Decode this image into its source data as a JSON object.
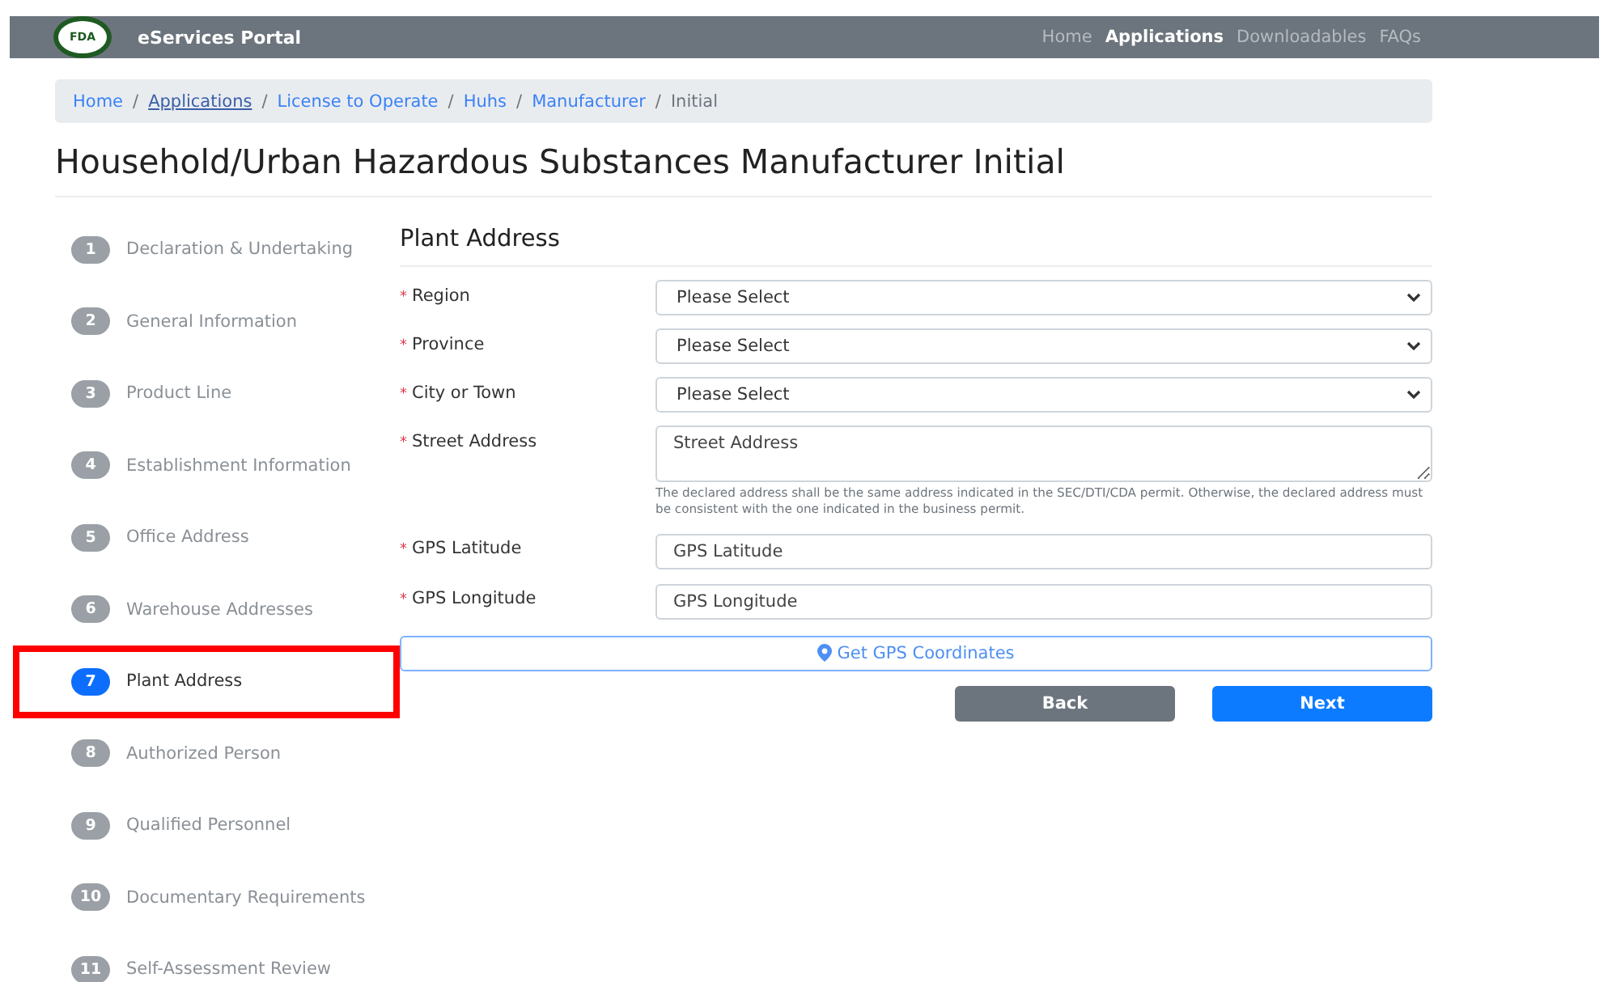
{
  "navbar": {
    "logo": "FDA",
    "title": "eServices Portal",
    "links": [
      {
        "label": "Home",
        "selected": false
      },
      {
        "label": "Applications",
        "selected": true
      },
      {
        "label": "Downloadables",
        "selected": false
      },
      {
        "label": "FAQs",
        "selected": false
      }
    ]
  },
  "breadcrumb": [
    {
      "kind": "link",
      "label": "Home",
      "underlined": false
    },
    {
      "kind": "separator",
      "label": "/"
    },
    {
      "kind": "link",
      "label": "Applications",
      "underlined": true
    },
    {
      "kind": "separator",
      "label": "/"
    },
    {
      "kind": "link",
      "label": "License to Operate",
      "underlined": false
    },
    {
      "kind": "separator",
      "label": "/"
    },
    {
      "kind": "link",
      "label": "Huhs",
      "underlined": false
    },
    {
      "kind": "separator",
      "label": "/"
    },
    {
      "kind": "link",
      "label": "Manufacturer",
      "underlined": false
    },
    {
      "kind": "separator",
      "label": "/"
    },
    {
      "kind": "current",
      "label": "Initial"
    }
  ],
  "page_title": "Household/Urban Hazardous Substances Manufacturer Initial",
  "steps": [
    {
      "number": "1",
      "label": "Declaration & Undertaking",
      "selected": false,
      "highlighted": false
    },
    {
      "number": "2",
      "label": "General Information",
      "selected": false,
      "highlighted": false
    },
    {
      "number": "3",
      "label": "Product Line",
      "selected": false,
      "highlighted": false
    },
    {
      "number": "4",
      "label": "Establishment Information",
      "selected": false,
      "highlighted": false
    },
    {
      "number": "5",
      "label": "Office Address",
      "selected": false,
      "highlighted": false
    },
    {
      "number": "6",
      "label": "Warehouse Addresses",
      "selected": false,
      "highlighted": false
    },
    {
      "number": "7",
      "label": "Plant Address",
      "selected": true,
      "highlighted": true
    },
    {
      "number": "8",
      "label": "Authorized Person",
      "selected": false,
      "highlighted": false
    },
    {
      "number": "9",
      "label": "Qualified Personnel",
      "selected": false,
      "highlighted": false
    },
    {
      "number": "10",
      "label": "Documentary Requirements",
      "selected": false,
      "highlighted": false
    },
    {
      "number": "11",
      "label": "Self-Assessment Review",
      "selected": false,
      "highlighted": false
    }
  ],
  "form": {
    "title": "Plant Address",
    "fields": [
      {
        "kind": "select",
        "label": "Region",
        "required_mark": "*",
        "value": "Please Select"
      },
      {
        "kind": "select",
        "label": "Province",
        "required_mark": "*",
        "value": "Please Select"
      },
      {
        "kind": "select",
        "label": "City or Town",
        "required_mark": "*",
        "value": "Please Select"
      },
      {
        "kind": "textarea",
        "label": "Street Address",
        "required_mark": "*",
        "placeholder": "Street Address",
        "help": "The declared address shall be the same address indicated in the SEC/DTI/CDA permit. Otherwise, the declared address must be consistent with the one indicated in the business permit."
      },
      {
        "kind": "input",
        "label": "GPS Latitude",
        "required_mark": "*",
        "placeholder": "GPS Latitude"
      },
      {
        "kind": "input",
        "label": "GPS Longitude",
        "required_mark": "*",
        "placeholder": "GPS Longitude"
      }
    ],
    "gps_button": "Get GPS Coordinates",
    "back_button": "Back",
    "next_button": "Next"
  }
}
